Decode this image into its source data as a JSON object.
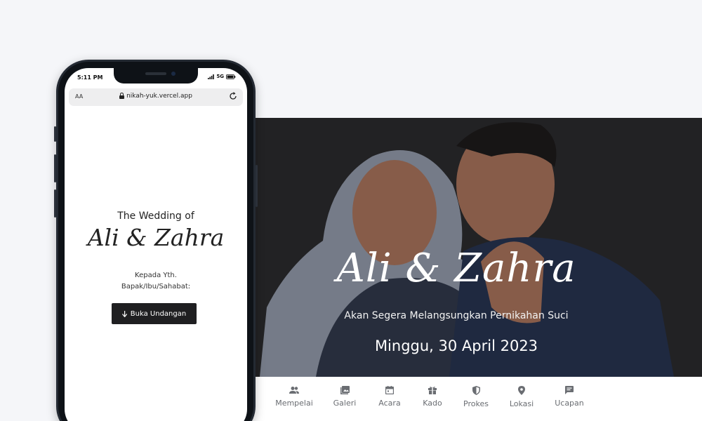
{
  "phone": {
    "status_time": "5:11 PM",
    "signal": "5G",
    "address_aa": "AA",
    "url": "nikah-yuk.vercel.app",
    "heading": "The Wedding of",
    "couple": "Ali & Zahra",
    "kepada": "Kepada Yth.",
    "guest": "Bapak/Ibu/Sahabat:",
    "open_button": "Buka Undangan"
  },
  "hero": {
    "title": "Ali & Zahra",
    "subtitle": "Akan Segera Melangsungkan Pernikahan Suci",
    "date": "Minggu, 30 April 2023"
  },
  "nav": {
    "items": [
      {
        "label": "Mempelai",
        "icon": "people-icon"
      },
      {
        "label": "Galeri",
        "icon": "gallery-icon"
      },
      {
        "label": "Acara",
        "icon": "calendar-icon"
      },
      {
        "label": "Kado",
        "icon": "gift-icon"
      },
      {
        "label": "Prokes",
        "icon": "shield-icon"
      },
      {
        "label": "Lokasi",
        "icon": "location-icon"
      },
      {
        "label": "Ucapan",
        "icon": "chat-icon"
      }
    ]
  },
  "colors": {
    "page_bg": "#f5f6f9",
    "hero_bg": "#2b2b2e",
    "nav_text": "#6a6d72",
    "button_bg": "#1f1f21"
  }
}
